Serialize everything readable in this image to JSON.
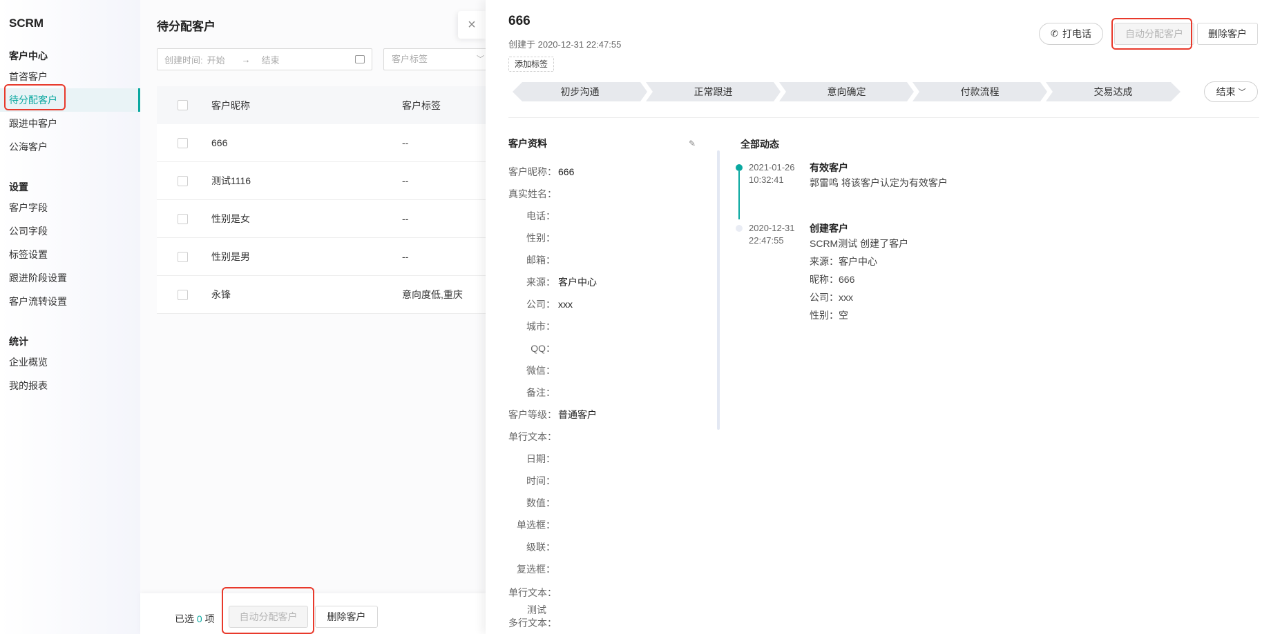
{
  "sidebar": {
    "brand": "SCRM",
    "groups": [
      {
        "title": "客户中心",
        "items": [
          "首咨客户",
          "待分配客户",
          "跟进中客户",
          "公海客户"
        ]
      },
      {
        "title": "设置",
        "items": [
          "客户字段",
          "公司字段",
          "标签设置",
          "跟进阶段设置",
          "客户流转设置"
        ]
      },
      {
        "title": "统计",
        "items": [
          "企业概览",
          "我的报表"
        ]
      }
    ]
  },
  "list": {
    "title": "待分配客户",
    "close_icon": "×",
    "date_label": "创建时间:",
    "date_start": "开始",
    "date_arrow": "→",
    "date_end": "结束",
    "tag_placeholder": "客户标签",
    "columns": [
      "客户昵称",
      "客户标签"
    ],
    "rows": [
      {
        "name": "666",
        "tag": "--"
      },
      {
        "name": "测试1116",
        "tag": "--"
      },
      {
        "name": "性别是女",
        "tag": "--"
      },
      {
        "name": "性别是男",
        "tag": "--"
      },
      {
        "name": "永锋",
        "tag": "意向度低,重庆"
      }
    ],
    "footer": {
      "selected_prefix": "已选",
      "selected_count": "0",
      "selected_suffix": "项",
      "auto_assign": "自动分配客户",
      "delete": "删除客户"
    }
  },
  "drawer": {
    "title": "666",
    "created": "创建于 2020-12-31 22:47:55",
    "add_tag": "添加标签",
    "call": "打电话",
    "auto_assign": "自动分配客户",
    "delete": "删除客户",
    "stages": [
      "初步沟通",
      "正常跟进",
      "意向确定",
      "付款流程",
      "交易达成"
    ],
    "end": "结束",
    "profile_title": "客户资料",
    "fields": [
      {
        "label": "客户昵称：",
        "value": "666"
      },
      {
        "label": "真实姓名：",
        "value": ""
      },
      {
        "label": "电话：",
        "value": ""
      },
      {
        "label": "性别：",
        "value": ""
      },
      {
        "label": "邮箱：",
        "value": ""
      },
      {
        "label": "来源：",
        "value": "客户中心"
      },
      {
        "label": "公司：",
        "value": "xxx"
      },
      {
        "label": "城市：",
        "value": ""
      },
      {
        "label": "QQ：",
        "value": ""
      },
      {
        "label": "微信：",
        "value": ""
      },
      {
        "label": "备注：",
        "value": ""
      },
      {
        "label": "客户等级：",
        "value": "普通客户"
      },
      {
        "label": "单行文本：",
        "value": ""
      },
      {
        "label": "日期：",
        "value": ""
      },
      {
        "label": "时间：",
        "value": ""
      },
      {
        "label": "数值：",
        "value": ""
      },
      {
        "label": "单选框：",
        "value": ""
      },
      {
        "label": "级联：",
        "value": ""
      },
      {
        "label": "复选框：",
        "value": ""
      }
    ],
    "field_two_line": {
      "label": "单行文本：",
      "wrap": "测试"
    },
    "field_last": {
      "label": "多行文本："
    },
    "activity_title": "全部动态",
    "activities": [
      {
        "date": "2021-01-26",
        "time": "10:32:41",
        "title": "有效客户",
        "lines": [
          "郭雷鸣 将该客户认定为有效客户"
        ]
      },
      {
        "date": "2020-12-31",
        "time": "22:47:55",
        "title": "创建客户",
        "lines": [
          "SCRM测试 创建了客户",
          "来源：客户中心",
          "昵称：666",
          "公司：xxx",
          "性别：空"
        ]
      }
    ]
  }
}
